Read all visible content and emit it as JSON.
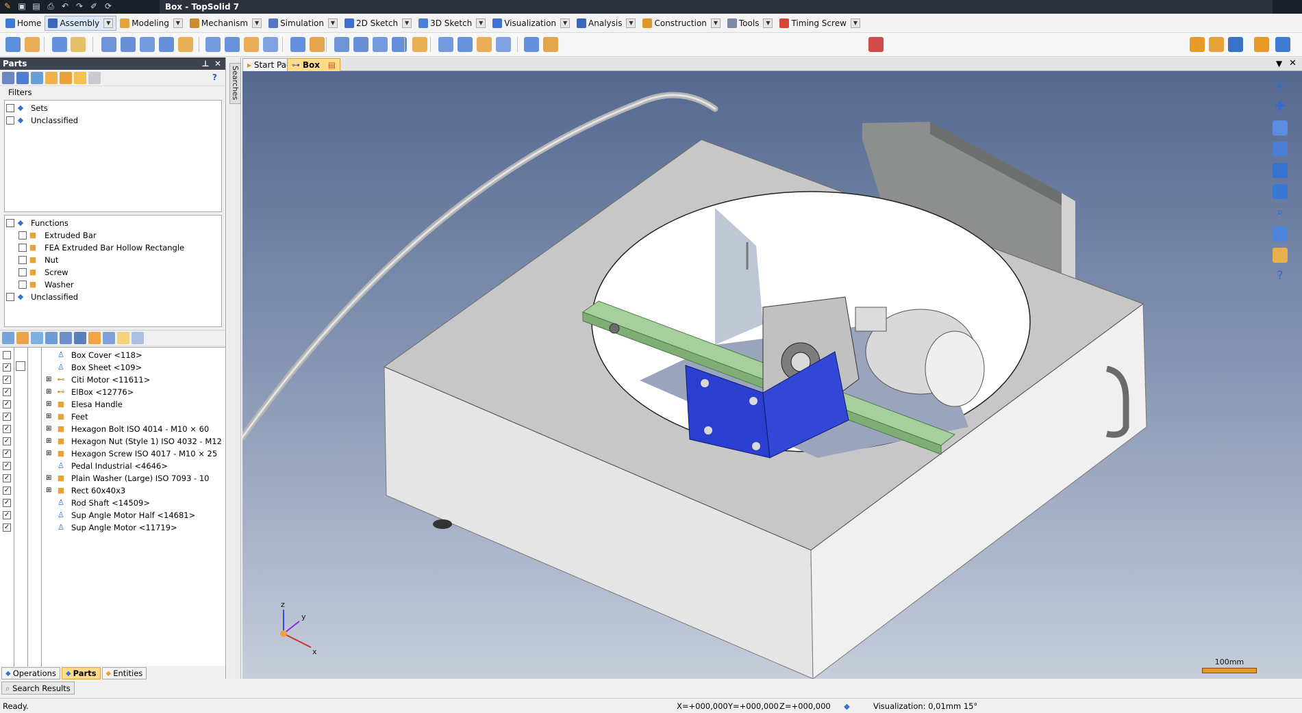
{
  "window": {
    "title": "Box - TopSolid 7"
  },
  "menu": {
    "tabs": [
      {
        "label": "Home",
        "icon": "home-icon"
      },
      {
        "label": "Assembly",
        "icon": "assembly-icon"
      },
      {
        "label": "Modeling",
        "icon": "modeling-icon"
      },
      {
        "label": "Mechanism",
        "icon": "mechanism-icon"
      },
      {
        "label": "Simulation",
        "icon": "simulation-icon"
      },
      {
        "label": "2D Sketch",
        "icon": "sketch-2d-icon"
      },
      {
        "label": "3D Sketch",
        "icon": "sketch-3d-icon"
      },
      {
        "label": "Visualization",
        "icon": "visualization-icon"
      },
      {
        "label": "Analysis",
        "icon": "analysis-icon"
      },
      {
        "label": "Construction",
        "icon": "construction-icon"
      },
      {
        "label": "Tools",
        "icon": "tools-icon"
      },
      {
        "label": "Timing Screw",
        "icon": "timing-screw-icon"
      }
    ],
    "active": "Assembly"
  },
  "parts_panel": {
    "title": "Parts",
    "filters_label": "Filters",
    "help": "?",
    "sets": [
      {
        "label": "Sets"
      },
      {
        "label": "Unclassified"
      }
    ],
    "functions": [
      {
        "label": "Functions",
        "level": 0
      },
      {
        "label": "Extruded Bar",
        "level": 1
      },
      {
        "label": "FEA Extruded Bar Hollow Rectangle",
        "level": 1
      },
      {
        "label": "Nut",
        "level": 1
      },
      {
        "label": "Screw",
        "level": 1
      },
      {
        "label": "Washer",
        "level": 1
      },
      {
        "label": "Unclassified",
        "level": 0
      }
    ],
    "parts": [
      {
        "label": "Box Cover <118>",
        "checked": false,
        "expand": false,
        "icon": "part-person-icon"
      },
      {
        "label": "Box Sheet <109>",
        "checked": true,
        "expand": false,
        "icon": "part-person-icon"
      },
      {
        "label": "Citi Motor <11611>",
        "checked": true,
        "expand": true,
        "icon": "assembly-link-icon"
      },
      {
        "label": "ElBox <12776>",
        "checked": true,
        "expand": true,
        "icon": "assembly-link-icon"
      },
      {
        "label": "Elesa Handle",
        "checked": true,
        "expand": true,
        "icon": "part-cube-icon"
      },
      {
        "label": "Feet",
        "checked": true,
        "expand": true,
        "icon": "part-cube-icon"
      },
      {
        "label": "Hexagon Bolt ISO 4014 - M10 × 60",
        "checked": true,
        "expand": true,
        "icon": "part-cube-icon"
      },
      {
        "label": "Hexagon Nut (Style 1) ISO 4032 - M12",
        "checked": true,
        "expand": true,
        "icon": "part-cube-icon"
      },
      {
        "label": "Hexagon Screw ISO 4017 - M10 × 25",
        "checked": true,
        "expand": true,
        "icon": "part-cube-icon"
      },
      {
        "label": "Pedal Industrial <4646>",
        "checked": true,
        "expand": false,
        "icon": "part-person-icon"
      },
      {
        "label": "Plain Washer (Large) ISO 7093 - 10",
        "checked": true,
        "expand": true,
        "icon": "part-cube-icon"
      },
      {
        "label": "Rect 60x40x3",
        "checked": true,
        "expand": true,
        "icon": "part-cube-icon"
      },
      {
        "label": "Rod Shaft <14509>",
        "checked": true,
        "expand": false,
        "icon": "part-person-icon"
      },
      {
        "label": "Sup Angle Motor  Half <14681>",
        "checked": true,
        "expand": false,
        "icon": "part-person-icon"
      },
      {
        "label": "Sup Angle Motor <11719>",
        "checked": true,
        "expand": false,
        "icon": "part-person-icon"
      }
    ]
  },
  "bottom_tabs": [
    {
      "label": "Operations",
      "active": false
    },
    {
      "label": "Parts",
      "active": true
    },
    {
      "label": "Entities",
      "active": false
    }
  ],
  "search_results_label": "Search Results",
  "side_tab": "Searches",
  "document_tabs": [
    {
      "label": "Start Page",
      "active": false
    },
    {
      "label": "Box",
      "active": true
    }
  ],
  "viewport": {
    "scale_label": "100mm",
    "axes": {
      "x": "x",
      "y": "y",
      "z": "z"
    }
  },
  "status": {
    "message": "Ready.",
    "x": "X=+000,000",
    "y": "Y=+000,000",
    "z": "Z=+000,000",
    "visualization": "Visualization: 0,01mm 15°"
  },
  "colors": {
    "accent_tab": "#ffdb8a",
    "panel_header": "#3d4450",
    "viewport_top": "#55688f",
    "viewport_bottom": "#c6cddb",
    "bracket_blue": "#2a3fcf",
    "rail_green": "#a7cf9e"
  }
}
